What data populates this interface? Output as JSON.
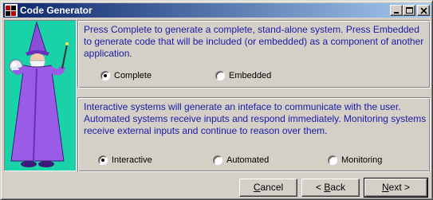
{
  "window": {
    "title": "Code Generator"
  },
  "title_icon": "app-icon",
  "titlebar_buttons": [
    "minimize-icon",
    "maximize-icon",
    "close-icon"
  ],
  "mascot": "wizard-illustration",
  "system_type": {
    "description": "Press Complete to generate a complete, stand-alone system. Press Embedded to generate code that will be included (or embedded) as a component of another application.",
    "options": [
      {
        "label": "Complete",
        "selected": true
      },
      {
        "label": "Embedded",
        "selected": false
      }
    ]
  },
  "interaction_type": {
    "description": "Interactive systems will generate an inteface to communicate with the user. Automated systems receive inputs and respond immediately. Monitoring systems receive external inputs and continue to reason over them.",
    "options": [
      {
        "label": "Interactive",
        "selected": true
      },
      {
        "label": "Automated",
        "selected": false
      },
      {
        "label": "Monitoring",
        "selected": false
      }
    ]
  },
  "buttons": {
    "cancel": {
      "mnemonic": "C",
      "rest": "ancel"
    },
    "back": {
      "prefix": "< ",
      "mnemonic": "B",
      "rest": "ack"
    },
    "next": {
      "mnemonic": "N",
      "rest": "ext >"
    }
  },
  "colors": {
    "description_text": "#1a1aa6",
    "wizard_background": "#1ad2a8",
    "titlebar": "#0a246a"
  }
}
